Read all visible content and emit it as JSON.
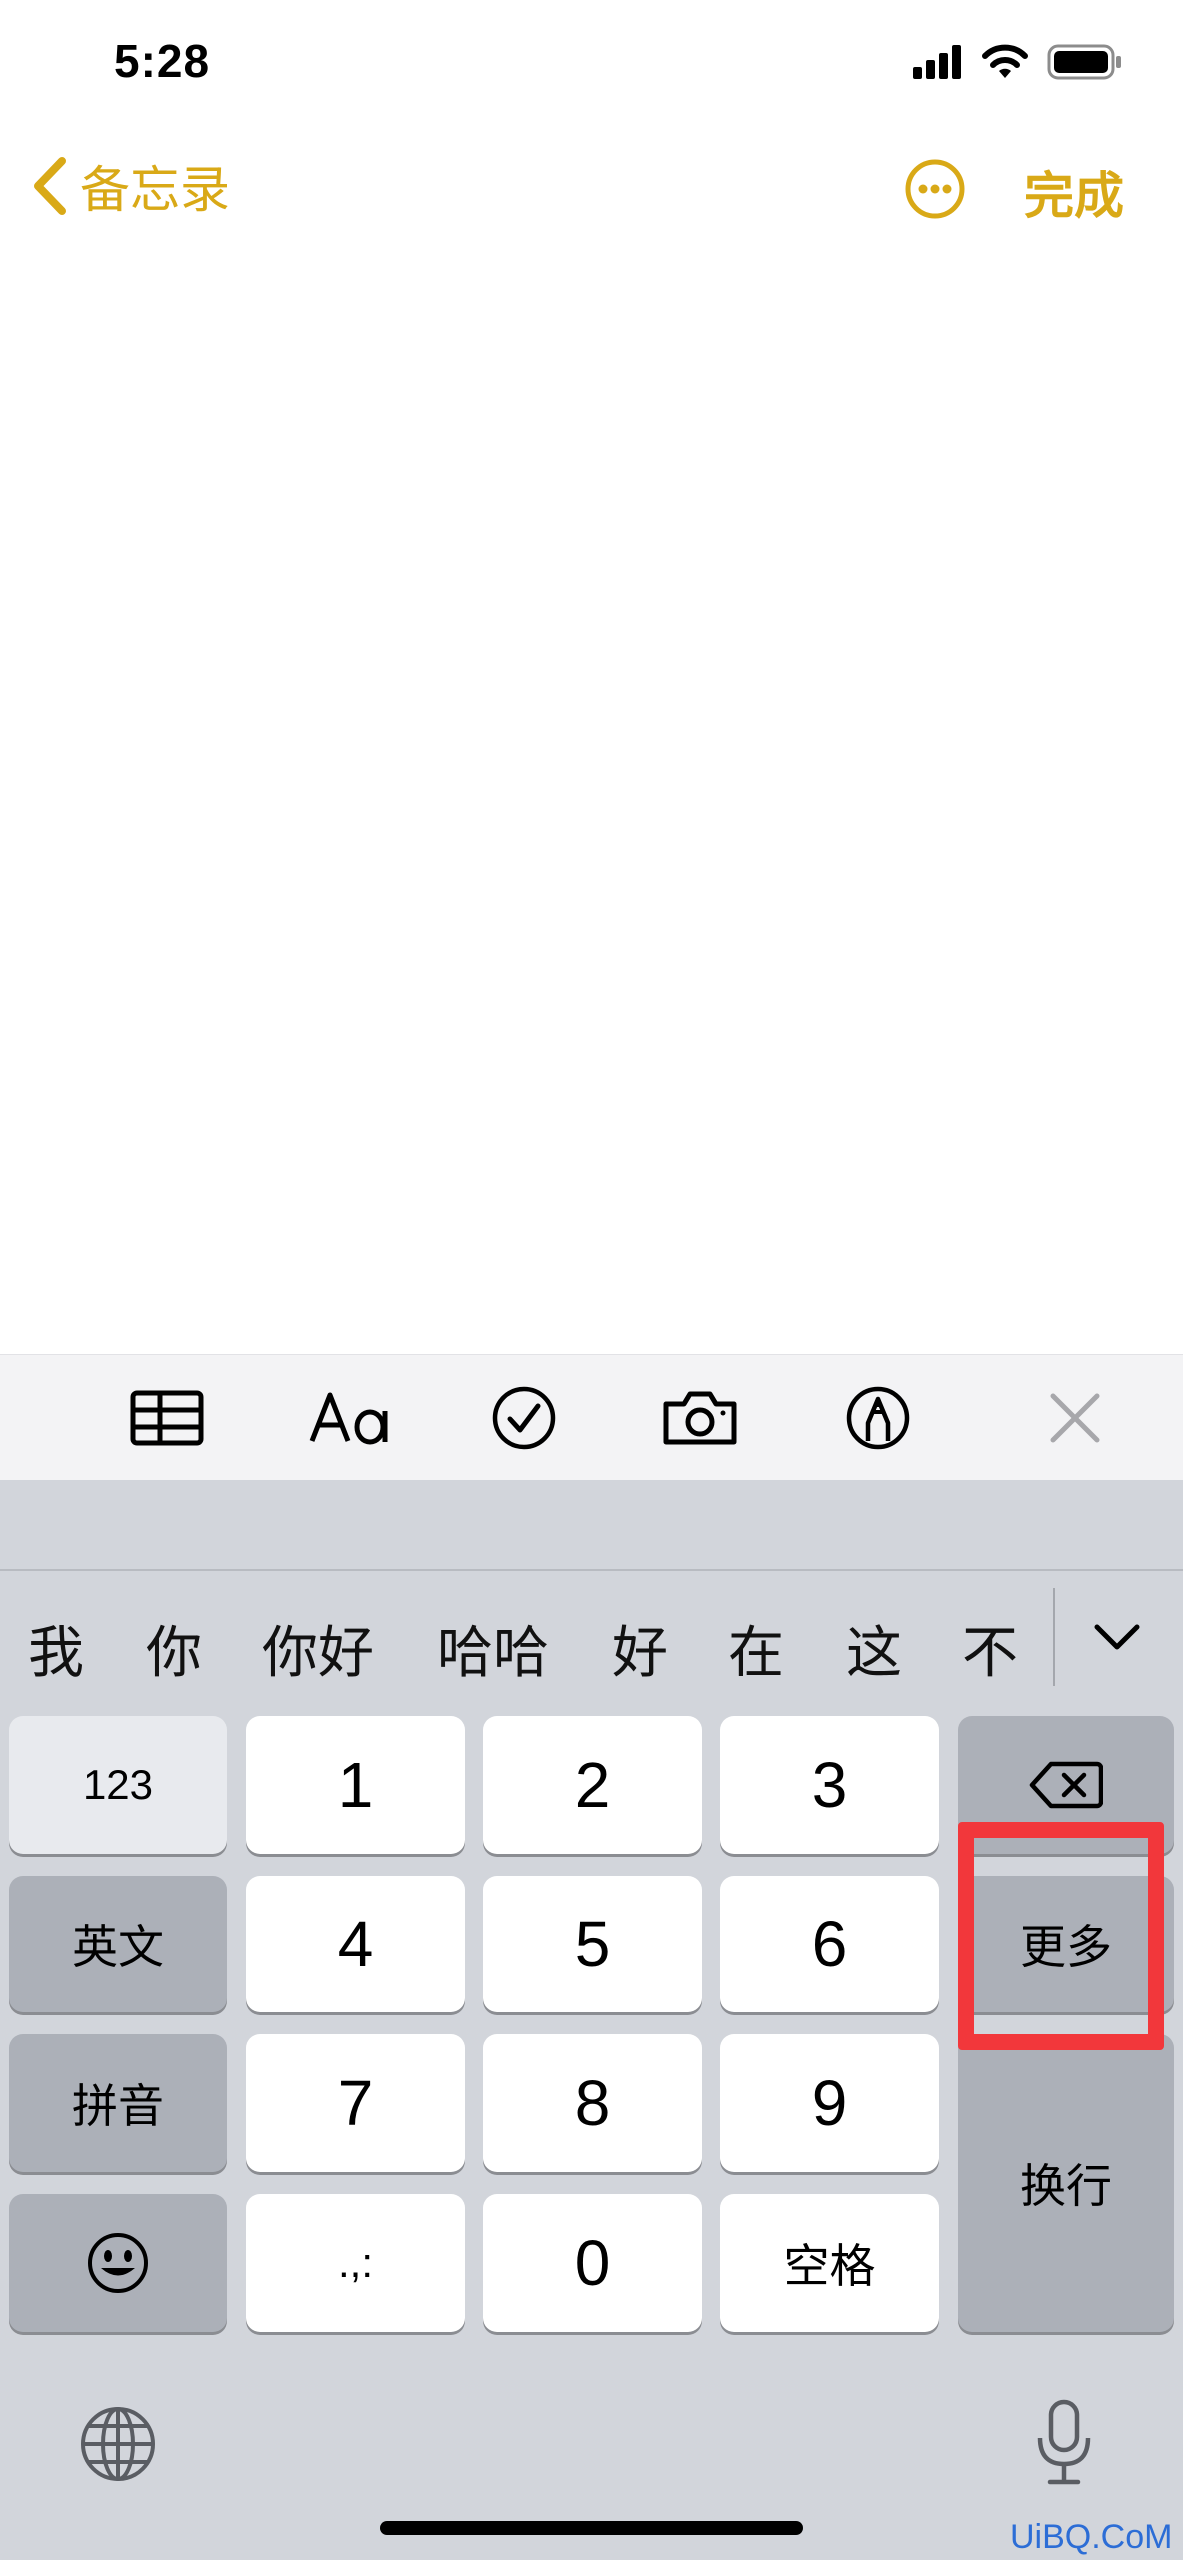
{
  "status_bar": {
    "time": "5:28"
  },
  "nav": {
    "back_label": "备忘录",
    "done_label": "完成"
  },
  "candidates": [
    "我",
    "你",
    "你好",
    "哈哈",
    "好",
    "在",
    "这",
    "不"
  ],
  "keys": {
    "row1": {
      "left": "123",
      "k1": "1",
      "k2": "2",
      "k3": "3"
    },
    "row2": {
      "left": "英文",
      "k1": "4",
      "k2": "5",
      "k3": "6",
      "right": "更多"
    },
    "row3": {
      "left": "拼音",
      "k1": "7",
      "k2": "8",
      "k3": "9"
    },
    "row4": {
      "k1": ".,:",
      "k2": "0",
      "k3": "空格"
    },
    "return_label": "换行"
  },
  "watermark": "UiBQ.CoM",
  "colors": {
    "accent": "#D9A917",
    "highlight": "#F2373B"
  },
  "icons": [
    "chevron-left-icon",
    "ellipsis-circle-icon",
    "table-icon",
    "text-format-icon",
    "checklist-icon",
    "camera-icon",
    "markup-pen-icon",
    "close-icon",
    "chevron-down-icon",
    "delete-icon",
    "emoji-icon",
    "globe-icon",
    "microphone-icon"
  ]
}
